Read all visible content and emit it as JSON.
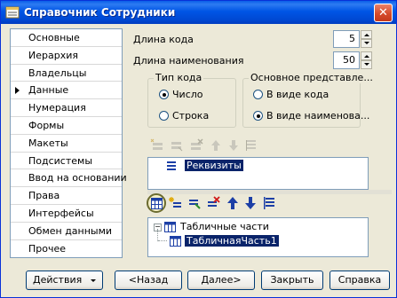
{
  "window": {
    "title": "Справочник Сотрудники",
    "close_glyph": "✕"
  },
  "nav": {
    "items": [
      {
        "label": "Основные",
        "active": false
      },
      {
        "label": "Иерархия",
        "active": false
      },
      {
        "label": "Владельцы",
        "active": false
      },
      {
        "label": "Данные",
        "active": true
      },
      {
        "label": "Нумерация",
        "active": false
      },
      {
        "label": "Формы",
        "active": false
      },
      {
        "label": "Макеты",
        "active": false
      },
      {
        "label": "Подсистемы",
        "active": false
      },
      {
        "label": "Ввод на основании",
        "active": false
      },
      {
        "label": "Права",
        "active": false
      },
      {
        "label": "Интерфейсы",
        "active": false
      },
      {
        "label": "Обмен данными",
        "active": false
      },
      {
        "label": "Прочее",
        "active": false
      }
    ]
  },
  "data_tab": {
    "code_length_label": "Длина кода",
    "code_length_value": "5",
    "name_length_label": "Длина наименования",
    "name_length_value": "50",
    "code_type": {
      "title": "Тип кода",
      "options": [
        {
          "label": "Число",
          "selected": true
        },
        {
          "label": "Строка",
          "selected": false
        }
      ]
    },
    "main_view": {
      "title": "Основное представле...",
      "options": [
        {
          "label": "В виде кода",
          "selected": false
        },
        {
          "label": "В виде наименова...",
          "selected": true
        }
      ]
    },
    "attributes_list": {
      "items": [
        "Реквизиты"
      ]
    },
    "tabular_tree": {
      "root": "Табличные части",
      "child": "ТабличнаяЧасть1"
    }
  },
  "buttons": {
    "actions": "Действия",
    "back": "<Назад",
    "next": "Далее>",
    "close": "Закрыть",
    "help": "Справка"
  }
}
